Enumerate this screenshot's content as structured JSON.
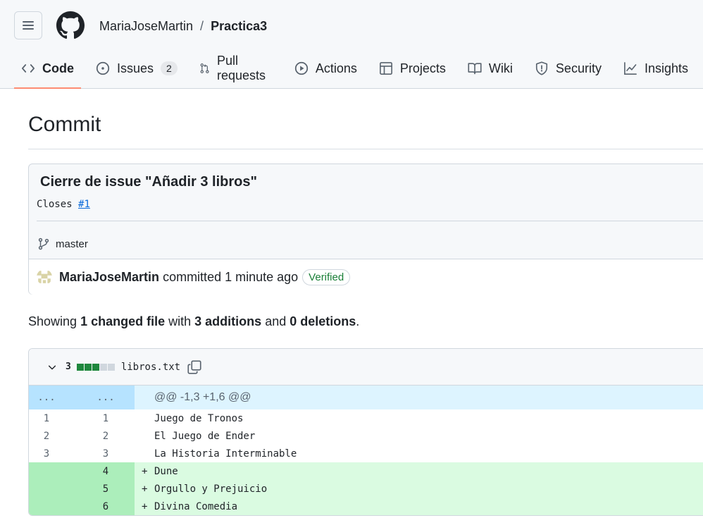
{
  "header": {
    "owner": "MariaJoseMartin",
    "separator": "/",
    "repo": "Practica3",
    "tabs": [
      {
        "label": "Code",
        "icon": "code-icon",
        "active": true
      },
      {
        "label": "Issues",
        "icon": "issue-opened-icon",
        "counter": "2"
      },
      {
        "label": "Pull requests",
        "icon": "git-pull-request-icon"
      },
      {
        "label": "Actions",
        "icon": "play-icon"
      },
      {
        "label": "Projects",
        "icon": "table-icon"
      },
      {
        "label": "Wiki",
        "icon": "book-icon"
      },
      {
        "label": "Security",
        "icon": "shield-icon"
      },
      {
        "label": "Insights",
        "icon": "graph-icon"
      }
    ]
  },
  "page": {
    "title": "Commit"
  },
  "commit": {
    "message": "Cierre de issue \"Añadir 3 libros\"",
    "body_prefix": "Closes",
    "body_link": "#1",
    "branch": "master",
    "author": "MariaJoseMartin",
    "action": "committed",
    "time": "1 minute ago",
    "badge": "Verified"
  },
  "summary": {
    "showing": "Showing",
    "changed": "1 changed file",
    "with": "with",
    "additions": "3 additions",
    "and": "and",
    "deletions": "0 deletions",
    "end": "."
  },
  "diff": {
    "count": "3",
    "filename": "libros.txt",
    "hunk_left": "...",
    "hunk_right": "...",
    "hunk_header": "@@ -1,3 +1,6 @@",
    "lines": [
      {
        "old": "1",
        "new": "1",
        "marker": "",
        "text": "Juego de Tronos",
        "type": "context"
      },
      {
        "old": "2",
        "new": "2",
        "marker": "",
        "text": "El Juego de Ender",
        "type": "context"
      },
      {
        "old": "3",
        "new": "3",
        "marker": "",
        "text": "La Historia Interminable",
        "type": "context"
      },
      {
        "old": "",
        "new": "4",
        "marker": "+",
        "text": "Dune",
        "type": "add"
      },
      {
        "old": "",
        "new": "5",
        "marker": "+",
        "text": "Orgullo y Prejuicio",
        "type": "add"
      },
      {
        "old": "",
        "new": "6",
        "marker": "+",
        "text": "Divina Comedia",
        "type": "add"
      }
    ]
  },
  "colors": {
    "accent_tab": "#fd8c73",
    "link": "#0969da",
    "verified": "#1a7f37",
    "add_bg": "#dafbe1",
    "hunk_bg": "#ddf4ff"
  }
}
